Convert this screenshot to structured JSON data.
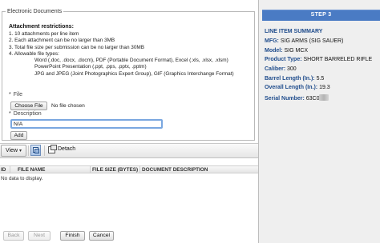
{
  "documents": {
    "legend": "Electronic Documents",
    "restrictions_title": "Attachment restrictions:",
    "restrictions": [
      "1. 10 attachments per line item",
      "2. Each attachment can be no larger than 3MB",
      "3. Total file size per submission can be no larger than 30MB",
      "4. Allowable file types:"
    ],
    "file_types": [
      "Word (.doc, .docx, .docm), PDF (Portable Document Format), Excel (.xls, .xlsx, .xlsm)",
      "PowerPoint Presentation (.ppt, .pps, .pptx, .pptm)",
      "JPG and JPEG (Joint Photographics Expert Group), GIF (Graphics Interchange Format)"
    ],
    "required_marker": "*",
    "file_label": "File",
    "choose_file_label": "Choose File",
    "no_file_text": "No file chosen",
    "description_label": "Description",
    "description_value": "N/A",
    "add_label": "Add"
  },
  "grid": {
    "view_label": "View",
    "view_arrow": "▾",
    "detach_label": "Detach",
    "columns": [
      "ID",
      "FILE NAME",
      "FILE SIZE (BYTES)",
      "DOCUMENT DESCRIPTION"
    ],
    "empty_text": "No data to display."
  },
  "footer": {
    "back": "Back",
    "next": "Next",
    "finish": "Finish",
    "cancel": "Cancel"
  },
  "summary": {
    "step_label": "STEP 3",
    "title": "LINE ITEM SUMMARY",
    "rows": [
      {
        "key": "MFG:",
        "value": "SIG ARMS (SIG SAUER)"
      },
      {
        "key": "Model:",
        "value": "SIG MCX"
      },
      {
        "key": "Product Type:",
        "value": "SHORT BARRELED RIFLE"
      },
      {
        "key": "Caliber:",
        "value": "300"
      },
      {
        "key": "Barrel Length (In.):",
        "value": "5.5"
      },
      {
        "key": "Overall Length (In.):",
        "value": "19.3"
      }
    ],
    "serial_key": "Serial Number:",
    "serial_value": "63C0"
  },
  "colors": {
    "step_bar": "#4a7bc4",
    "summary_key": "#1f4c8c",
    "right_panel_bg": "#efefef"
  }
}
